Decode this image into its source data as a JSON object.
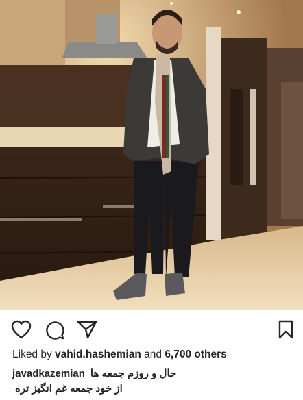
{
  "post": {
    "photo_alt": "",
    "actions": {
      "like_icon": "heart-outline-icon",
      "comment_icon": "comment-bubble-icon",
      "share_icon": "paper-plane-icon",
      "save_icon": "bookmark-outline-icon"
    },
    "likes": {
      "prefix": "Liked by",
      "user": "vahid.hashemian",
      "middle": "and",
      "count": "6,700 others"
    },
    "caption": {
      "username": "javadkazemian",
      "line1": "حال و روزم جمعه ها",
      "line2": "از خود جمعه غم انگیز تره"
    }
  },
  "colors": {
    "text": "#262626",
    "icon": "#262626",
    "background": "#ffffff"
  }
}
